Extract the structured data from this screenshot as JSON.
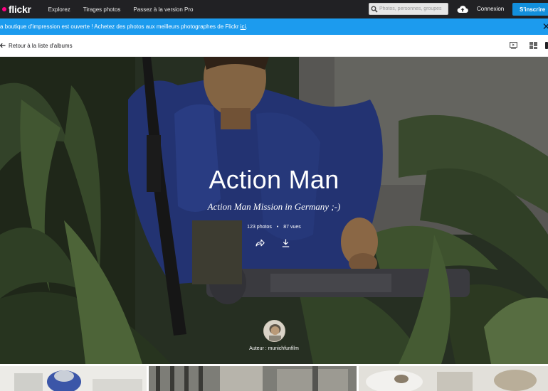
{
  "nav": {
    "logo_text": "flickr",
    "links": [
      "Explorez",
      "Tirages photos",
      "Passez à la version Pro"
    ],
    "search_placeholder": "Photos, personnes, groupes",
    "login_label": "Connexion",
    "signup_label": "S'inscrire",
    "upload_icon": "cloud-upload-icon"
  },
  "banner": {
    "message": "a boutique d'impression est ouverte ! Achetez des photos aux meilleurs photographes de Flickr ",
    "link_text": "ici",
    "message_end": ".",
    "close_icon": "close-icon"
  },
  "subbar": {
    "back_label": "Retour à la liste d'albums",
    "slideshow_icon": "slideshow-icon",
    "layout_icon": "layout-grid-icon"
  },
  "album": {
    "title": "Action Man",
    "description": "Action Man Mission in Germany ;-)",
    "photo_count": "123 photos",
    "separator": "•",
    "view_count": "87 vues",
    "share_icon": "share-icon",
    "download_icon": "download-icon",
    "author_label": "Auteur : munichfunfilm"
  },
  "colors": {
    "nav_bg": "#212124",
    "brand_pink": "#ff0084",
    "brand_blue": "#128fdc",
    "banner_bg": "#1c9bee"
  }
}
